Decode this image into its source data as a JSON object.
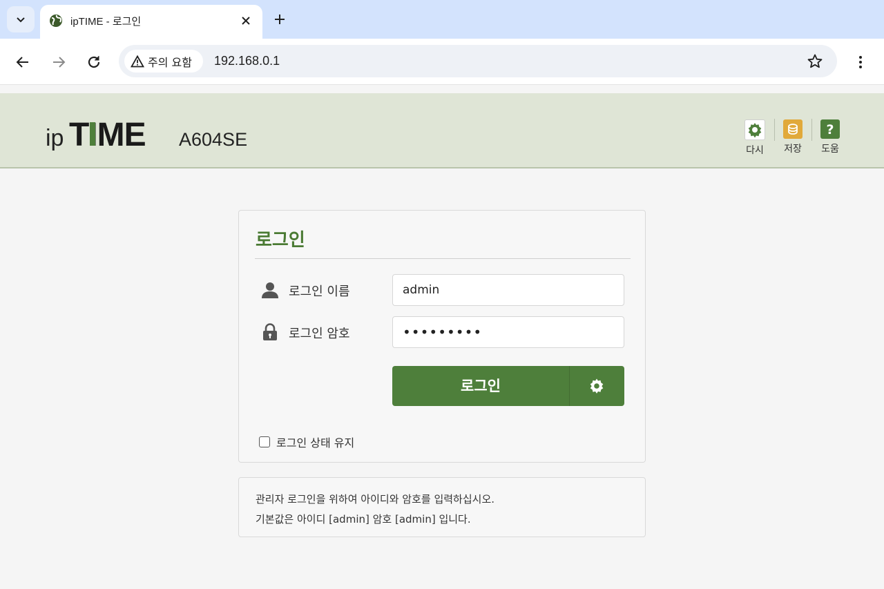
{
  "browser": {
    "tab_title": "ipTIME - 로그인",
    "security_chip": "주의 요함",
    "url": "192.168.0.1"
  },
  "header": {
    "brand": "ipTIME",
    "model": "A604SE",
    "buttons": [
      {
        "label": "다시",
        "icon": "gear-icon",
        "color": "#4e7f3b"
      },
      {
        "label": "저장",
        "icon": "database-icon",
        "color": "#e1a93a"
      },
      {
        "label": "도움",
        "icon": "help-icon",
        "color": "#4e7f3b"
      }
    ]
  },
  "login": {
    "title": "로그인",
    "username_label": "로그인 이름",
    "username_value": "admin",
    "password_label": "로그인 암호",
    "password_display": "•••••••••",
    "submit_label": "로그인",
    "keep_label": "로그인 상태 유지",
    "keep_checked": false
  },
  "info": {
    "line1": "관리자 로그인을 위하여 아이디와 암호를 입력하십시오.",
    "line2": "기본값은 아이디 [admin] 암호 [admin] 입니다."
  },
  "colors": {
    "accent_green": "#4e7f3b",
    "header_bg": "#dfe5d6",
    "save_orange": "#e1a93a"
  }
}
